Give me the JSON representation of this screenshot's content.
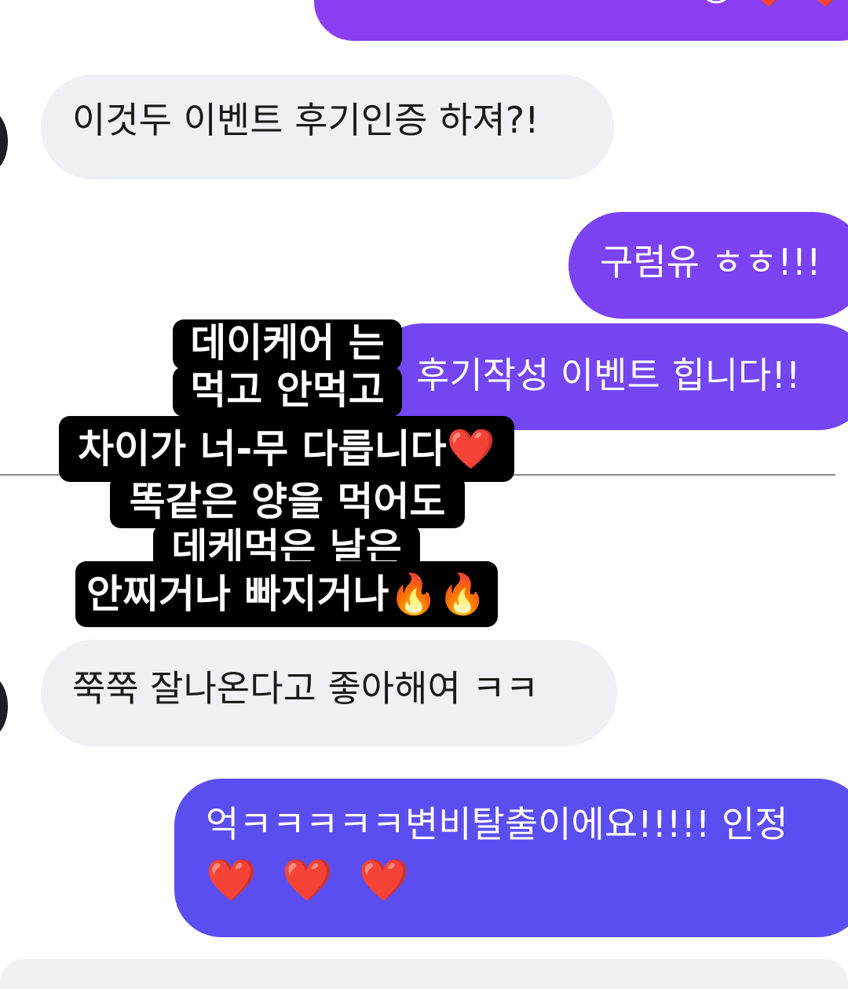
{
  "messages": [
    {
      "id": "m0",
      "side": "outgoing",
      "text": "",
      "emoji": "😊 ❤️ ❤️"
    },
    {
      "id": "m1",
      "side": "incoming",
      "text": "이것두 이벤트 후기인증 하져?!"
    },
    {
      "id": "m2",
      "side": "outgoing",
      "text": "구럼유 ㅎㅎ!!!"
    },
    {
      "id": "m3",
      "side": "outgoing",
      "text": "후기작성 이벤트 힙니다!!"
    },
    {
      "id": "m4",
      "side": "incoming",
      "text": "쭉쭉 잘나온다고 좋아해여 ㅋㅋ"
    },
    {
      "id": "m5",
      "side": "outgoing",
      "text": "억ㅋㅋㅋㅋㅋ변비탈출이에요!!!!! 인정",
      "emoji": "❤️ ❤️ ❤️"
    }
  ],
  "overlay_caption": {
    "lines": [
      "데이케어 는",
      "먹고 안먹고",
      "차이가 너-무 다릅니다❤️",
      "똑같은 양을 먹어도",
      "데케먹은 날은",
      "안찌거나 빠지거나🔥🔥"
    ]
  },
  "colors": {
    "outgoing_bubble_top": "#8b3ff0",
    "outgoing_bubble_bottom": "#5b4ef0",
    "incoming_bubble": "#eff0f3",
    "caption_background": "#000000",
    "caption_text": "#ffffff"
  }
}
